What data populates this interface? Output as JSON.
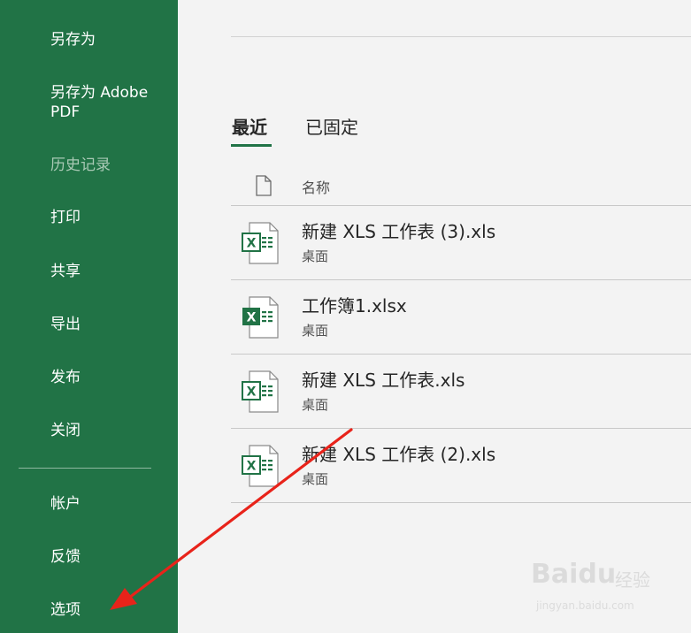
{
  "sidebar": {
    "items": [
      {
        "label": "另存为"
      },
      {
        "label": "另存为 Adobe PDF"
      },
      {
        "label": "历史记录"
      },
      {
        "label": "打印"
      },
      {
        "label": "共享"
      },
      {
        "label": "导出"
      },
      {
        "label": "发布"
      },
      {
        "label": "关闭"
      },
      {
        "label": "帐户"
      },
      {
        "label": "反馈"
      },
      {
        "label": "选项"
      }
    ]
  },
  "main": {
    "tabs": [
      {
        "label": "最近"
      },
      {
        "label": "已固定"
      }
    ],
    "column_header": "名称",
    "files": [
      {
        "name": "新建 XLS 工作表 (3).xls",
        "location": "桌面",
        "icon": "excel-xls-icon"
      },
      {
        "name": "工作簿1.xlsx",
        "location": "桌面",
        "icon": "excel-xlsx-icon"
      },
      {
        "name": "新建 XLS 工作表.xls",
        "location": "桌面",
        "icon": "excel-xls-icon"
      },
      {
        "name": "新建 XLS 工作表 (2).xls",
        "location": "桌面",
        "icon": "excel-xls-icon"
      }
    ]
  },
  "watermark": {
    "brand": "Baidu",
    "text": "经验",
    "url": "jingyan.baidu.com"
  },
  "colors": {
    "sidebar_bg": "#217346",
    "main_bg": "#f3f3f3",
    "accent": "#217346",
    "arrow": "#e8231a"
  }
}
